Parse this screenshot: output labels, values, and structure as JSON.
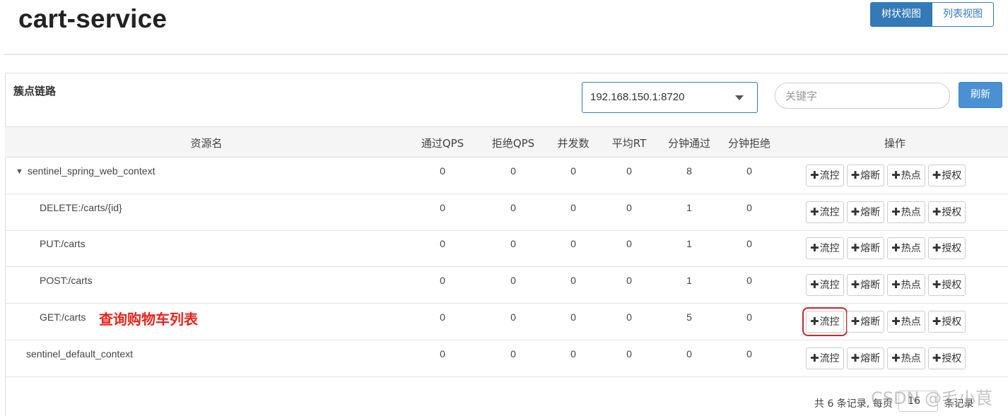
{
  "app": {
    "title": "cart-service"
  },
  "view_toggle": {
    "tree": "树状视图",
    "list": "列表视图"
  },
  "panel": {
    "title": "簇点链路",
    "machine": "192.168.150.1:8720",
    "search_placeholder": "关键字",
    "refresh": "刷新"
  },
  "table": {
    "headers": [
      "资源名",
      "通过QPS",
      "拒绝QPS",
      "并发数",
      "平均RT",
      "分钟通过",
      "分钟拒绝",
      "操作"
    ],
    "ops": [
      "流控",
      "熔断",
      "热点",
      "授权"
    ],
    "rows": [
      {
        "name": "sentinel_spring_web_context",
        "values": [
          "0",
          "0",
          "0",
          "0",
          "8",
          "0"
        ]
      },
      {
        "name": "DELETE:/carts/{id}",
        "values": [
          "0",
          "0",
          "0",
          "0",
          "1",
          "0"
        ]
      },
      {
        "name": "PUT:/carts",
        "values": [
          "0",
          "0",
          "0",
          "0",
          "1",
          "0"
        ]
      },
      {
        "name": "POST:/carts",
        "values": [
          "0",
          "0",
          "0",
          "0",
          "1",
          "0"
        ]
      },
      {
        "name": "GET:/carts",
        "values": [
          "0",
          "0",
          "0",
          "0",
          "5",
          "0"
        ],
        "annotation": "查询购物车列表"
      },
      {
        "name": "sentinel_default_context",
        "values": [
          "0",
          "0",
          "0",
          "0",
          "0",
          "0"
        ]
      }
    ]
  },
  "pager": {
    "prefix": "共 6 条记录, 每页",
    "page_size": "16",
    "suffix": "条记录"
  },
  "watermark": "CSDN @毛小茛",
  "colors": {
    "primary": "#337ab7",
    "refresh": "#4a90d2",
    "annotation": "#e8241c",
    "highlight": "#c9262c"
  }
}
